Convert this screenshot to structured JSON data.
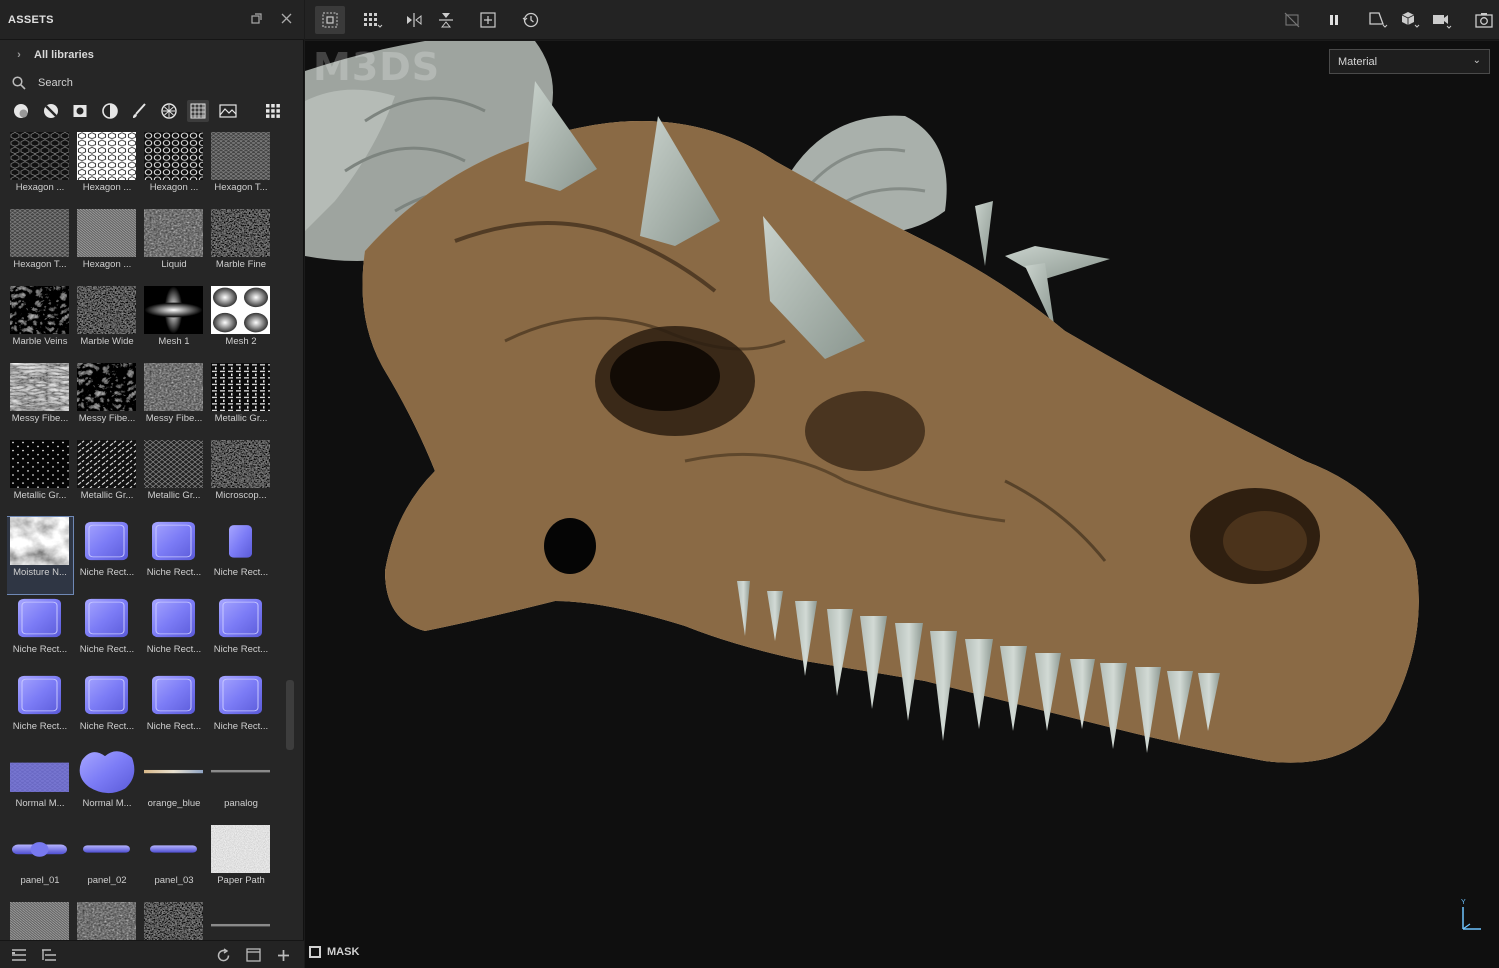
{
  "assets_panel": {
    "title": "ASSETS",
    "libraries_label": "All libraries",
    "search_placeholder": "Search",
    "filter_icons": [
      "material-sphere-icon",
      "smart-material-icon",
      "smart-mask-icon",
      "filter-icon",
      "brush-icon",
      "particles-icon",
      "texture-grid-icon",
      "environment-icon"
    ],
    "items": [
      {
        "label": "Hexagon ...",
        "pattern": "hex-dark"
      },
      {
        "label": "Hexagon ...",
        "pattern": "hex-white"
      },
      {
        "label": "Hexagon ...",
        "pattern": "hex-rings"
      },
      {
        "label": "Hexagon T...",
        "pattern": "hex-fine"
      },
      {
        "label": "Hexagon T...",
        "pattern": "hex-fine"
      },
      {
        "label": "Hexagon ...",
        "pattern": "lines-fine"
      },
      {
        "label": "Liquid",
        "pattern": "noise-grey"
      },
      {
        "label": "Marble Fine",
        "pattern": "noise-dark"
      },
      {
        "label": "Marble Veins",
        "pattern": "noise-veins"
      },
      {
        "label": "Marble Wide",
        "pattern": "noise-dark"
      },
      {
        "label": "Mesh 1",
        "pattern": "mesh1"
      },
      {
        "label": "Mesh 2",
        "pattern": "mesh2"
      },
      {
        "label": "Messy Fibe...",
        "pattern": "fiber-light"
      },
      {
        "label": "Messy Fibe...",
        "pattern": "fiber-dark"
      },
      {
        "label": "Messy Fibe...",
        "pattern": "noise-grey"
      },
      {
        "label": "Metallic Gr...",
        "pattern": "metal-grid"
      },
      {
        "label": "Metallic Gr...",
        "pattern": "metal-dots"
      },
      {
        "label": "Metallic Gr...",
        "pattern": "metal-diag"
      },
      {
        "label": "Metallic Gr...",
        "pattern": "metal-weave"
      },
      {
        "label": "Microscop...",
        "pattern": "noise-dark"
      },
      {
        "label": "Moisture N...",
        "pattern": "moisture"
      },
      {
        "label": "Niche Rect...",
        "pattern": "normal-rect"
      },
      {
        "label": "Niche Rect...",
        "pattern": "normal-rect"
      },
      {
        "label": "Niche Rect...",
        "pattern": "normal-small"
      },
      {
        "label": "Niche Rect...",
        "pattern": "normal-rect"
      },
      {
        "label": "Niche Rect...",
        "pattern": "normal-rect"
      },
      {
        "label": "Niche Rect...",
        "pattern": "normal-rect"
      },
      {
        "label": "Niche Rect...",
        "pattern": "normal-rect"
      },
      {
        "label": "Niche Rect...",
        "pattern": "normal-rect"
      },
      {
        "label": "Niche Rect...",
        "pattern": "normal-rect"
      },
      {
        "label": "Niche Rect...",
        "pattern": "normal-rect"
      },
      {
        "label": "Niche Rect...",
        "pattern": "normal-rect"
      },
      {
        "label": "Normal M...",
        "pattern": "normal-bumps"
      },
      {
        "label": "Normal M...",
        "pattern": "normal-blob"
      },
      {
        "label": "orange_blue",
        "pattern": "line-gradient"
      },
      {
        "label": "panalog",
        "pattern": "line-grey"
      },
      {
        "label": "panel_01",
        "pattern": "panel-1"
      },
      {
        "label": "panel_02",
        "pattern": "panel-2"
      },
      {
        "label": "panel_03",
        "pattern": "panel-2"
      },
      {
        "label": "Paper Path",
        "pattern": "paper"
      },
      {
        "label": "",
        "pattern": "lines-fine"
      },
      {
        "label": "",
        "pattern": "noise-grey"
      },
      {
        "label": "",
        "pattern": "noise-dark"
      },
      {
        "label": "",
        "pattern": "line-grey"
      }
    ],
    "selected_index": 20,
    "footer_icons": [
      "list-view-icon",
      "tree-view-icon",
      "refresh-icon",
      "new-window-icon",
      "add-icon"
    ]
  },
  "viewport": {
    "view_mode": "Material",
    "mask_label": "MASK",
    "watermark": "M3DS",
    "axis_label": "Y"
  },
  "toolbar": {
    "left_icons": [
      "symmetry-grid-icon",
      "tiling-icon",
      "mirror-x-icon",
      "mirror-y-icon",
      "fit-view-icon",
      "history-icon"
    ],
    "right_icons": [
      "hide-icon",
      "pause-icon",
      "display-settings-icon",
      "camera-3d-icon",
      "video-camera-icon",
      "screenshot-icon"
    ]
  },
  "colors": {
    "panel_bg": "#262626",
    "viewport_bg": "#0f0f0f",
    "normal_map_blue": "#7b7df5",
    "selection": "#6f88b5"
  }
}
